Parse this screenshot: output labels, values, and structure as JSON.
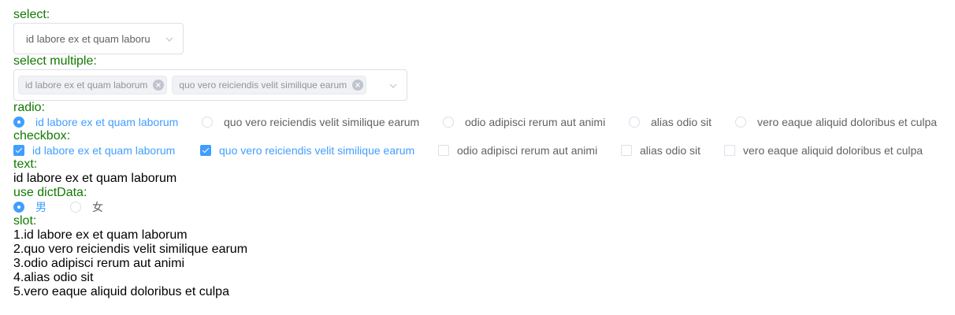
{
  "select": {
    "label": "select:",
    "value": "id labore ex et quam laboru"
  },
  "select_multiple": {
    "label": "select multiple:",
    "tags": [
      "id labore ex et quam laborum",
      "quo vero reiciendis velit similique earum"
    ]
  },
  "radio": {
    "label": "radio:",
    "options": [
      "id labore ex et quam laborum",
      "quo vero reiciendis velit similique earum",
      "odio adipisci rerum aut animi",
      "alias odio sit",
      "vero eaque aliquid doloribus et culpa"
    ],
    "selected_index": 0
  },
  "checkbox": {
    "label": "checkbox:",
    "options": [
      "id labore ex et quam laborum",
      "quo vero reiciendis velit similique earum",
      "odio adipisci rerum aut animi",
      "alias odio sit",
      "vero eaque aliquid doloribus et culpa"
    ],
    "checked": [
      true,
      true,
      false,
      false,
      false
    ]
  },
  "text": {
    "label": "text:",
    "value": "id labore ex et quam laborum"
  },
  "dict": {
    "label": "use dictData:",
    "options": [
      "男",
      "女"
    ],
    "selected_index": 0
  },
  "slot": {
    "label": "slot:",
    "lines": [
      "1.id labore ex et quam laborum",
      "2.quo vero reiciendis velit similique earum",
      "3.odio adipisci rerum aut animi",
      "4.alias odio sit",
      "5.vero eaque aliquid doloribus et culpa"
    ]
  },
  "colors": {
    "label_green": "#117a00",
    "accent_blue": "#409eff",
    "text_gray": "#606266",
    "border_gray": "#dcdfe6"
  },
  "icons": {
    "select_arrow": "chevron-down-icon",
    "tag_remove": "close-circle-icon"
  }
}
